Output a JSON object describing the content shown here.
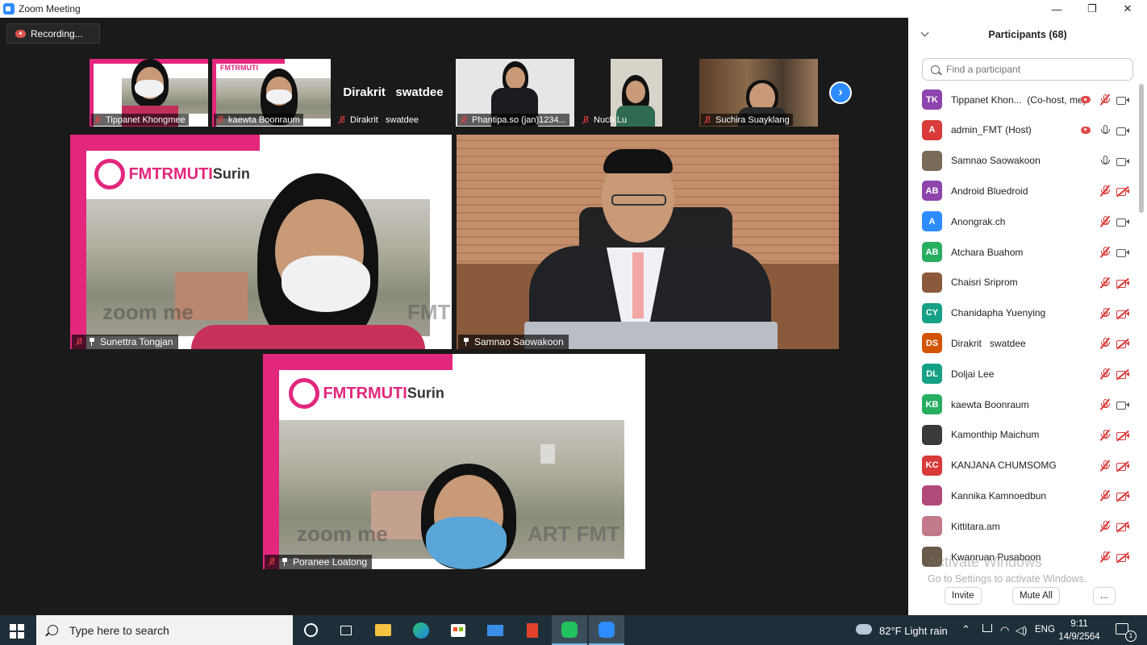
{
  "window": {
    "title": "Zoom Meeting",
    "minimize": "—",
    "restore": "❐",
    "close": "✕"
  },
  "recording": {
    "label": "Recording..."
  },
  "thumbnails": [
    {
      "name": "Tippanet Khongmee"
    },
    {
      "name": "kaewta Boonraum"
    },
    {
      "name": "Dirakrit   swatdee",
      "display": "Dirakrit   swatdee"
    },
    {
      "name": "Phantipa.so (jan)1234..."
    },
    {
      "name": "Nuch Lu"
    },
    {
      "name": "Suchira Suayklang"
    }
  ],
  "tiles": [
    {
      "name": "Sunettra Tongjan",
      "logo": "FMTRMUTISurin",
      "logo_suffix": "Surin",
      "watermark": "zoom me",
      "watermark2": "FMT"
    },
    {
      "name": "Samnao Saowakoon"
    },
    {
      "name": "Poranee Loatong",
      "logo": "FMTRMUTISurin",
      "logo_suffix": "Surin",
      "watermark": "zoom me",
      "watermark2": "ART FMT"
    }
  ],
  "logo_main": "FMTRMUTI",
  "panel": {
    "title": "Participants (68)",
    "search_placeholder": "Find a participant",
    "participants": [
      {
        "initials": "TK",
        "name": "Tippanet Khon...  (Co-host, me)",
        "color": "#8e44ad",
        "rec": true,
        "mic": "muted",
        "cam": "on"
      },
      {
        "initials": "A",
        "name": "admin_FMT (Host)",
        "color": "#d93a3a",
        "rec": true,
        "mic": "on",
        "cam": "on"
      },
      {
        "initials": "",
        "name": "Samnao Saowakoon",
        "color": "#7a6a5a",
        "rec": false,
        "mic": "on",
        "cam": "on"
      },
      {
        "initials": "AB",
        "name": "Android Bluedroid",
        "color": "#8e44ad",
        "rec": false,
        "mic": "muted",
        "cam": "off"
      },
      {
        "initials": "A",
        "name": "Anongrak.ch",
        "color": "#2d8cff",
        "rec": false,
        "mic": "muted",
        "cam": "on"
      },
      {
        "initials": "AB",
        "name": "Atchara Buahom",
        "color": "#27ae60",
        "rec": false,
        "mic": "muted",
        "cam": "on"
      },
      {
        "initials": "",
        "name": "Chaisri Sriprom",
        "color": "#8b5a3c",
        "rec": false,
        "mic": "muted",
        "cam": "off"
      },
      {
        "initials": "CY",
        "name": "Chanidapha Yuenying",
        "color": "#16a085",
        "rec": false,
        "mic": "muted",
        "cam": "off"
      },
      {
        "initials": "DS",
        "name": "Dirakrit   swatdee",
        "color": "#d35400",
        "rec": false,
        "mic": "muted",
        "cam": "off"
      },
      {
        "initials": "DL",
        "name": "Doljai Lee",
        "color": "#16a085",
        "rec": false,
        "mic": "muted",
        "cam": "off"
      },
      {
        "initials": "KB",
        "name": "kaewta Boonraum",
        "color": "#27ae60",
        "rec": false,
        "mic": "muted",
        "cam": "on"
      },
      {
        "initials": "",
        "name": "Kamonthip Maichum",
        "color": "#3a3a3a",
        "rec": false,
        "mic": "muted",
        "cam": "off"
      },
      {
        "initials": "KC",
        "name": "KANJANA CHUMSOMG",
        "color": "#d93a3a",
        "rec": false,
        "mic": "muted",
        "cam": "off"
      },
      {
        "initials": "",
        "name": "Kannika Kamnoedbun",
        "color": "#b04a7a",
        "rec": false,
        "mic": "muted",
        "cam": "off"
      },
      {
        "initials": "",
        "name": "Kittitara.am",
        "color": "#c07a8a",
        "rec": false,
        "mic": "muted",
        "cam": "off"
      },
      {
        "initials": "",
        "name": "Kwanruan Pusaboon",
        "color": "#6a5a4a",
        "rec": false,
        "mic": "muted",
        "cam": "off"
      }
    ],
    "activate_title": "Activate Windows",
    "activate_sub": "Go to Settings to activate Windows.",
    "invite": "Invite",
    "mute_all": "Mute All",
    "more": "..."
  },
  "taskbar": {
    "search_placeholder": "Type here to search",
    "weather": "82°F  Light rain",
    "lang": "ENG",
    "time": "9:11",
    "date": "14/9/2564",
    "notif_count": "1"
  }
}
